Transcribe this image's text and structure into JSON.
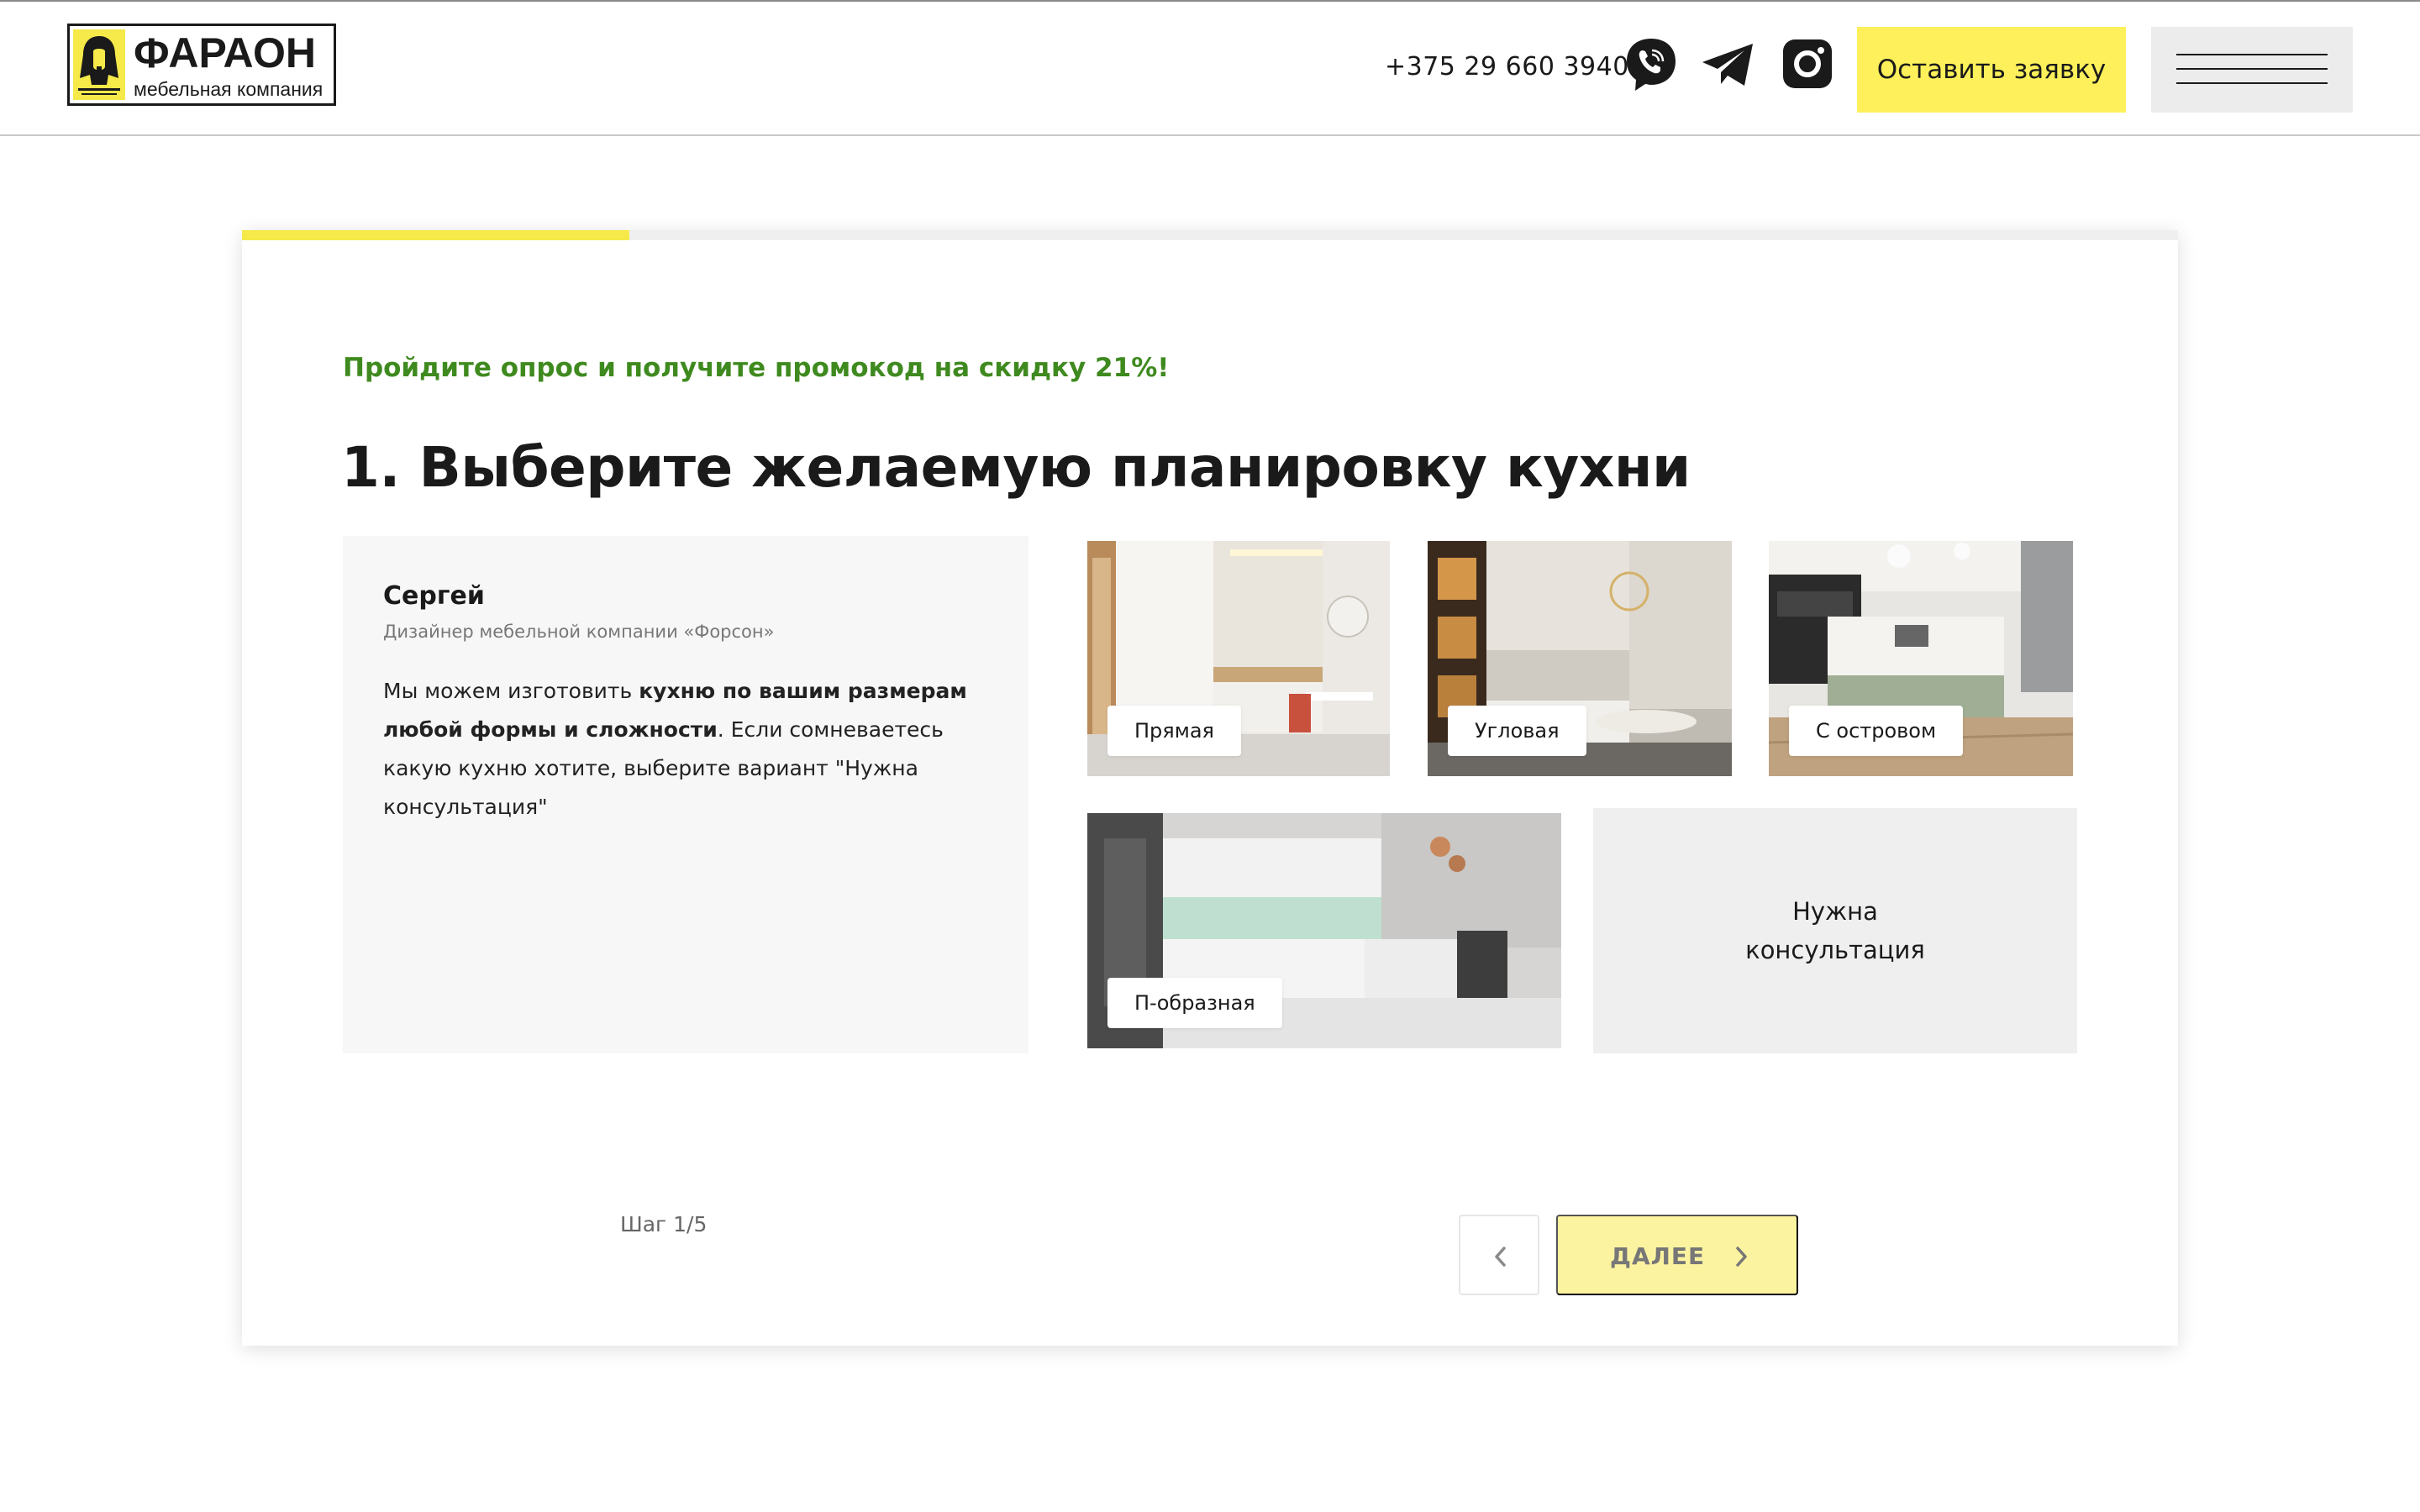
{
  "header": {
    "logo": {
      "name": "ФАРАОН",
      "subtitle": "мебельная компания"
    },
    "phone": "+375 29 660 3940",
    "social_icons": [
      "viber-icon",
      "telegram-icon",
      "instagram-icon"
    ],
    "cta_label": "Оставить заявку",
    "menu_icon": "hamburger-icon"
  },
  "quiz": {
    "progress": {
      "current": 1,
      "total": 5
    },
    "promo": "Пройдите опрос и получите промокод на скидку 21%!",
    "question": "1. Выберите желаемую планировку кухни",
    "consultant": {
      "name": "Сергей",
      "role": "Дизайнер мебельной компании «Форсон»",
      "text_1": "Мы можем изготовить ",
      "text_bold": "кухню по вашим размерам любой формы и сложности",
      "text_2": ". Если сомневаетесь какую кухню хотите, выберите вариант \"Нужна консультация\""
    },
    "options": [
      {
        "label": "Прямая"
      },
      {
        "label": "Угловая"
      },
      {
        "label": "С островом"
      },
      {
        "label": "П-образная"
      },
      {
        "label": "Нужна консультация"
      }
    ],
    "step_label": "Шаг 1/5",
    "next_label": "ДАЛЕЕ"
  },
  "colors": {
    "accent_yellow": "#fdf05a",
    "promo_green": "#3f8a1f",
    "next_disabled": "#fcf3a0",
    "progress_track": "#efefef"
  }
}
